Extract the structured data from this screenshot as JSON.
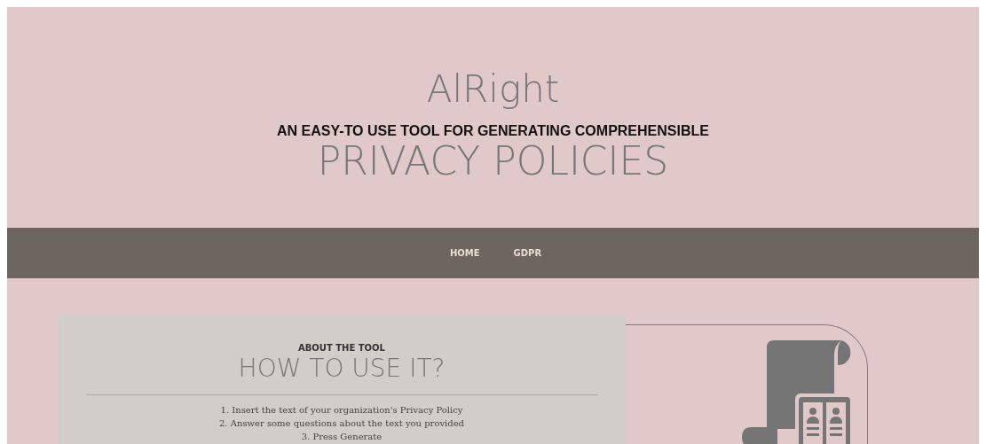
{
  "header": {
    "title": "AlRight",
    "tagline": "AN EASY-TO USE TOOL FOR GENERATING COMPREHENSIBLE",
    "subtitle": "PRIVACY POLICIES"
  },
  "nav": {
    "items": [
      "HOME",
      "GDPR"
    ]
  },
  "about": {
    "eyebrow": "ABOUT THE TOOL",
    "heading": "HOW TO USE IT?",
    "steps": [
      "1. Insert the text of your organization's Privacy Policy",
      "2. Answer some questions about the text you provided",
      "3. Press Generate"
    ]
  }
}
